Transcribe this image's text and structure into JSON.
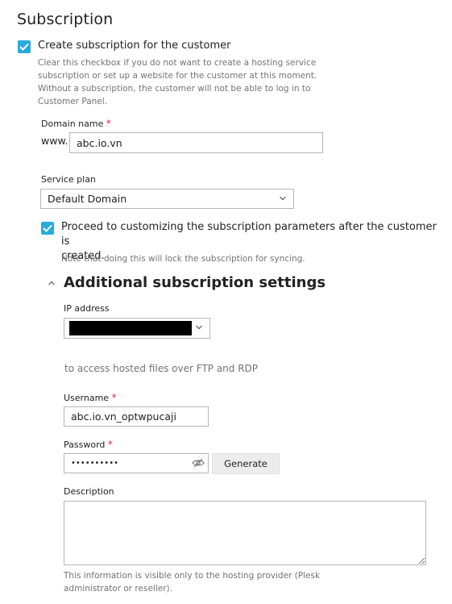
{
  "section": {
    "title": "Subscription"
  },
  "create_subscription": {
    "checked": true,
    "label": "Create subscription for the customer",
    "hint_lines": [
      "Clear this checkbox if you do not want to create a hosting service",
      "subscription or set up a website for the customer at this moment.",
      "Without a subscription, the customer will not be able to log in to",
      "Customer Panel."
    ]
  },
  "domain": {
    "label": "Domain name",
    "required_mark": "*",
    "prefix": "www.",
    "value": "abc.io.vn"
  },
  "service_plan": {
    "label": "Service plan",
    "selected": "Default Domain"
  },
  "customize": {
    "checked": true,
    "label_line1": "Proceed to customizing the subscription parameters after the customer is",
    "label_line2": "created.",
    "hint": "Note that doing this will lock the subscription for syncing."
  },
  "additional": {
    "title": "Additional subscription settings",
    "expanded": true,
    "ip_address": {
      "label": "IP address",
      "value_redacted": true
    },
    "ftp_note": "to access hosted files over FTP and RDP",
    "username": {
      "label": "Username",
      "required_mark": "*",
      "value": "abc.io.vn_optwpucaji"
    },
    "password": {
      "label": "Password",
      "required_mark": "*",
      "masked_value": "••••••••••",
      "generate_label": "Generate"
    },
    "description": {
      "label": "Description",
      "value": "",
      "hint_lines": [
        "This information is visible only to the hosting provider (Plesk",
        "administrator or reseller)."
      ]
    }
  },
  "colors": {
    "accent": "#28aadc",
    "required": "#d02d4b",
    "hint_text": "#737373"
  },
  "icons": {
    "checkbox": "checkmark-icon",
    "dropdown": "chevron-down-icon",
    "collapse": "chevron-up-icon",
    "password_toggle": "eye-slash-icon"
  }
}
